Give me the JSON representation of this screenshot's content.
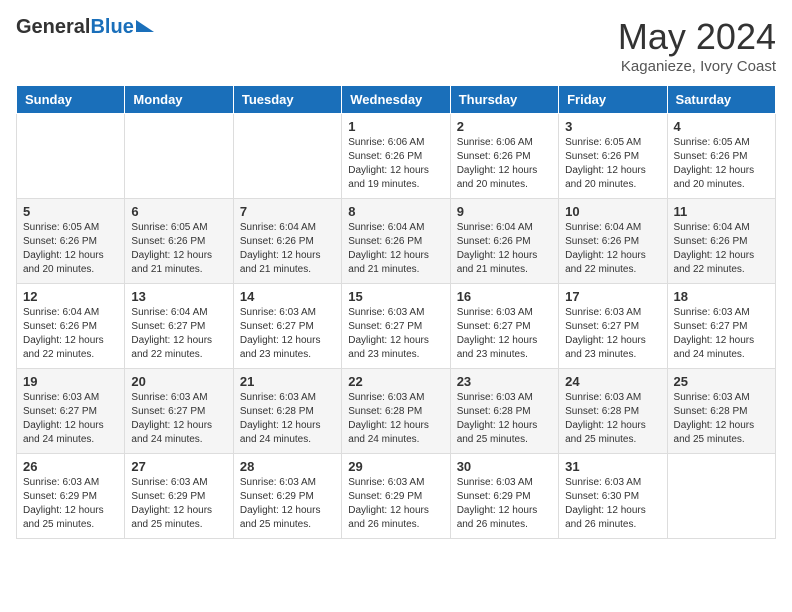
{
  "header": {
    "logo_general": "General",
    "logo_blue": "Blue",
    "month_year": "May 2024",
    "location": "Kaganieze, Ivory Coast"
  },
  "days_of_week": [
    "Sunday",
    "Monday",
    "Tuesday",
    "Wednesday",
    "Thursday",
    "Friday",
    "Saturday"
  ],
  "weeks": [
    [
      {
        "day": "",
        "info": ""
      },
      {
        "day": "",
        "info": ""
      },
      {
        "day": "",
        "info": ""
      },
      {
        "day": "1",
        "info": "Sunrise: 6:06 AM\nSunset: 6:26 PM\nDaylight: 12 hours\nand 19 minutes."
      },
      {
        "day": "2",
        "info": "Sunrise: 6:06 AM\nSunset: 6:26 PM\nDaylight: 12 hours\nand 20 minutes."
      },
      {
        "day": "3",
        "info": "Sunrise: 6:05 AM\nSunset: 6:26 PM\nDaylight: 12 hours\nand 20 minutes."
      },
      {
        "day": "4",
        "info": "Sunrise: 6:05 AM\nSunset: 6:26 PM\nDaylight: 12 hours\nand 20 minutes."
      }
    ],
    [
      {
        "day": "5",
        "info": "Sunrise: 6:05 AM\nSunset: 6:26 PM\nDaylight: 12 hours\nand 20 minutes."
      },
      {
        "day": "6",
        "info": "Sunrise: 6:05 AM\nSunset: 6:26 PM\nDaylight: 12 hours\nand 21 minutes."
      },
      {
        "day": "7",
        "info": "Sunrise: 6:04 AM\nSunset: 6:26 PM\nDaylight: 12 hours\nand 21 minutes."
      },
      {
        "day": "8",
        "info": "Sunrise: 6:04 AM\nSunset: 6:26 PM\nDaylight: 12 hours\nand 21 minutes."
      },
      {
        "day": "9",
        "info": "Sunrise: 6:04 AM\nSunset: 6:26 PM\nDaylight: 12 hours\nand 21 minutes."
      },
      {
        "day": "10",
        "info": "Sunrise: 6:04 AM\nSunset: 6:26 PM\nDaylight: 12 hours\nand 22 minutes."
      },
      {
        "day": "11",
        "info": "Sunrise: 6:04 AM\nSunset: 6:26 PM\nDaylight: 12 hours\nand 22 minutes."
      }
    ],
    [
      {
        "day": "12",
        "info": "Sunrise: 6:04 AM\nSunset: 6:26 PM\nDaylight: 12 hours\nand 22 minutes."
      },
      {
        "day": "13",
        "info": "Sunrise: 6:04 AM\nSunset: 6:27 PM\nDaylight: 12 hours\nand 22 minutes."
      },
      {
        "day": "14",
        "info": "Sunrise: 6:03 AM\nSunset: 6:27 PM\nDaylight: 12 hours\nand 23 minutes."
      },
      {
        "day": "15",
        "info": "Sunrise: 6:03 AM\nSunset: 6:27 PM\nDaylight: 12 hours\nand 23 minutes."
      },
      {
        "day": "16",
        "info": "Sunrise: 6:03 AM\nSunset: 6:27 PM\nDaylight: 12 hours\nand 23 minutes."
      },
      {
        "day": "17",
        "info": "Sunrise: 6:03 AM\nSunset: 6:27 PM\nDaylight: 12 hours\nand 23 minutes."
      },
      {
        "day": "18",
        "info": "Sunrise: 6:03 AM\nSunset: 6:27 PM\nDaylight: 12 hours\nand 24 minutes."
      }
    ],
    [
      {
        "day": "19",
        "info": "Sunrise: 6:03 AM\nSunset: 6:27 PM\nDaylight: 12 hours\nand 24 minutes."
      },
      {
        "day": "20",
        "info": "Sunrise: 6:03 AM\nSunset: 6:27 PM\nDaylight: 12 hours\nand 24 minutes."
      },
      {
        "day": "21",
        "info": "Sunrise: 6:03 AM\nSunset: 6:28 PM\nDaylight: 12 hours\nand 24 minutes."
      },
      {
        "day": "22",
        "info": "Sunrise: 6:03 AM\nSunset: 6:28 PM\nDaylight: 12 hours\nand 24 minutes."
      },
      {
        "day": "23",
        "info": "Sunrise: 6:03 AM\nSunset: 6:28 PM\nDaylight: 12 hours\nand 25 minutes."
      },
      {
        "day": "24",
        "info": "Sunrise: 6:03 AM\nSunset: 6:28 PM\nDaylight: 12 hours\nand 25 minutes."
      },
      {
        "day": "25",
        "info": "Sunrise: 6:03 AM\nSunset: 6:28 PM\nDaylight: 12 hours\nand 25 minutes."
      }
    ],
    [
      {
        "day": "26",
        "info": "Sunrise: 6:03 AM\nSunset: 6:29 PM\nDaylight: 12 hours\nand 25 minutes."
      },
      {
        "day": "27",
        "info": "Sunrise: 6:03 AM\nSunset: 6:29 PM\nDaylight: 12 hours\nand 25 minutes."
      },
      {
        "day": "28",
        "info": "Sunrise: 6:03 AM\nSunset: 6:29 PM\nDaylight: 12 hours\nand 25 minutes."
      },
      {
        "day": "29",
        "info": "Sunrise: 6:03 AM\nSunset: 6:29 PM\nDaylight: 12 hours\nand 26 minutes."
      },
      {
        "day": "30",
        "info": "Sunrise: 6:03 AM\nSunset: 6:29 PM\nDaylight: 12 hours\nand 26 minutes."
      },
      {
        "day": "31",
        "info": "Sunrise: 6:03 AM\nSunset: 6:30 PM\nDaylight: 12 hours\nand 26 minutes."
      },
      {
        "day": "",
        "info": ""
      }
    ]
  ]
}
